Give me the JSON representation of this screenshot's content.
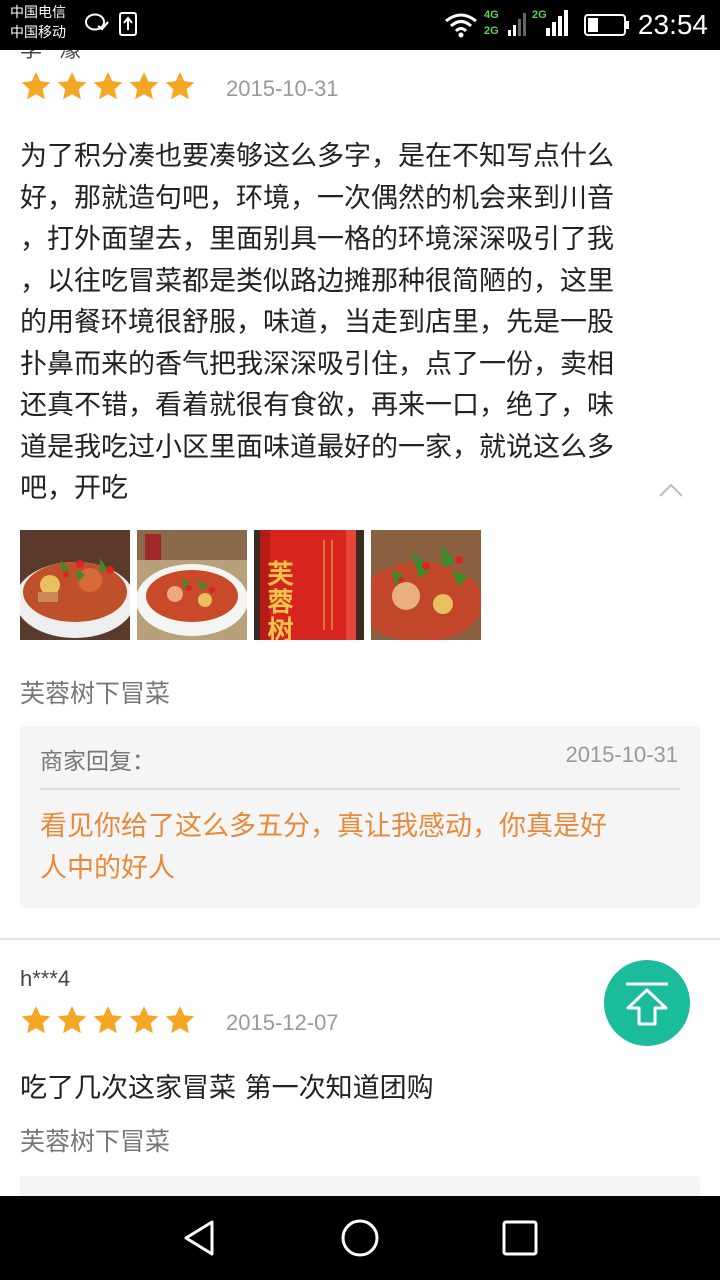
{
  "status_bar": {
    "carrier_1": "中国电信",
    "carrier_2": "中国移动",
    "net_1_top": "4G",
    "net_1_bottom": "2G",
    "net_2": "2G",
    "time": "23:54",
    "icons": [
      "wechat-notification-icon",
      "upload-icon",
      "wifi-icon",
      "signal-icon",
      "signal-icon",
      "battery-icon"
    ]
  },
  "reviews": [
    {
      "username": "李**濛",
      "rating": 5,
      "date": "2015-10-31",
      "text": "为了积分凑也要凑够这么多字，是在不知写点什么好，那就造句吧，环境，一次偶然的机会来到川音，打外面望去，里面别具一格的环境深深吸引了我，以往吃冒菜都是类似路边摊那种很简陋的，这里的用餐环境很舒服，味道，当走到店里，先是一股扑鼻而来的香气把我深深吸引住，点了一份，卖相还真不错，看着就很有食欲，再来一口，绝了，味道是我吃过小区里面味道最好的一家，就说这么多吧，开吃",
      "text_lines": [
        "为了积分凑也要凑够这么多字，是在不知写点什么",
        "好，那就造句吧，环境，一次偶然的机会来到川音",
        "，打外面望去，里面别具一格的环境深深吸引了我",
        "，以往吃冒菜都是类似路边摊那种很简陋的，这里",
        "的用餐环境很舒服，味道，当走到店里，先是一股",
        "扑鼻而来的香气把我深深吸引住，点了一份，卖相",
        "还真不错，看着就很有食欲，再来一口，绝了，味",
        "道是我吃过小区里面味道最好的一家，就说这么多",
        "吧，开吃"
      ],
      "photo_sign_text": "芙蓉树下",
      "shop": "芙蓉树下冒菜",
      "reply": {
        "label": "商家回复：",
        "date": "2015-10-31",
        "text_lines": [
          "看见你给了这么多五分，真让我感动，你真是好",
          "人中的好人"
        ]
      }
    },
    {
      "username": "h***4",
      "rating": 5,
      "date": "2015-12-07",
      "text": "吃了几次这家冒菜 第一次知道团购",
      "shop": "芙蓉树下冒菜"
    }
  ],
  "colors": {
    "star": "#f5a623",
    "reply_text": "#e8893a",
    "fab": "#1abc9c"
  }
}
